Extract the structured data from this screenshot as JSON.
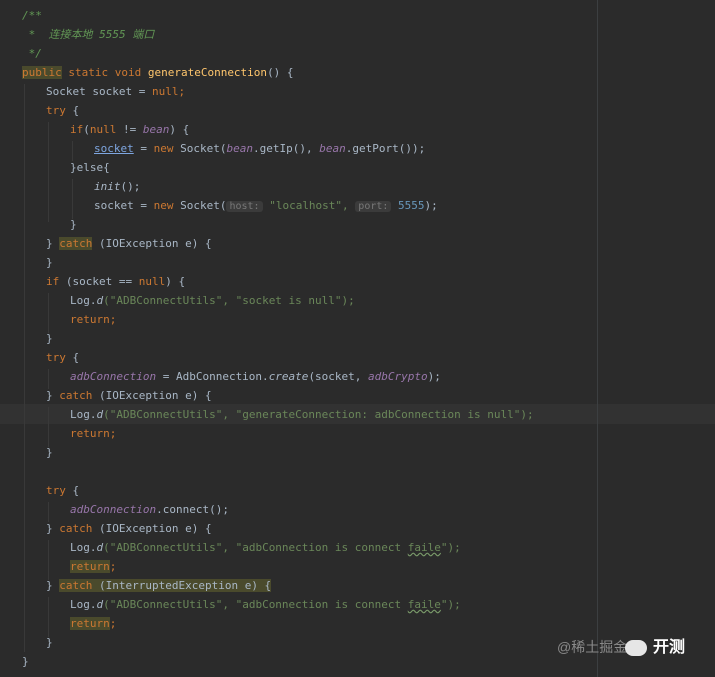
{
  "code": {
    "comment_open": "/**",
    "comment_body": " *  连接本地 5555 端口",
    "comment_close": " */",
    "l4_pub": "public",
    "l4_rest": " static void ",
    "l4_name": "generateConnection",
    "l4_tail": "() {",
    "l5_a": "Socket socket = ",
    "l5_null": "null",
    "l5_semi": ";",
    "try": "try",
    "brace_open": " {",
    "l7_if": "if",
    "l7_paren": "(",
    "l7_null": "null",
    "l7_ne": " != ",
    "l7_bean": "bean",
    "l7_close": ") {",
    "l8_socket": "socket",
    "l8_eq": " = ",
    "l8_new": "new",
    "l8_socketcall": " Socket(",
    "l8_bean1": "bean",
    "l8_getip": ".getIp(), ",
    "l8_bean2": "bean",
    "l8_getport": ".getPort());",
    "l9": "}else{",
    "l10_init": "init",
    "l10_rest": "();",
    "l11_a": "socket = ",
    "l11_new": "new",
    "l11_b": " Socket(",
    "l11_hint_host": "host:",
    "l11_str": " \"localhost\",",
    "l11_hint_port": "port:",
    "l11_num": " 5555",
    "l11_end": ");",
    "close": "}",
    "l13_open": "} ",
    "catch": "catch",
    "l13_exc": " (IOException e) {",
    "l15_if": "if",
    "l15_a": " (socket == ",
    "l15_null": "null",
    "l15_b": ") {",
    "log": "Log.",
    "d": "d",
    "l16_args": "(\"ADBConnectUtils\", \"socket is null\");",
    "return": "return",
    "semi": ";",
    "l20_field": "adbConnection",
    "l20_a": " = AdbConnection.",
    "l20_create": "create",
    "l20_b": "(socket, ",
    "l20_crypto": "adbCrypto",
    "l20_c": ");",
    "l22_args": "(\"ADBConnectUtils\", \"generateConnection: adbConnection is null\");",
    "l26_field": "adbConnection",
    "l26_rest": ".connect();",
    "l28_args_a": "(\"ADBConnectUtils\", \"adbConnection is connect ",
    "l28_faile": "faile",
    "l28_args_b": "\");",
    "l30_exc": " (InterruptedException e) {",
    "final_close": "}"
  },
  "watermark": {
    "handle": "@稀土掘金",
    "brand": "开测"
  }
}
